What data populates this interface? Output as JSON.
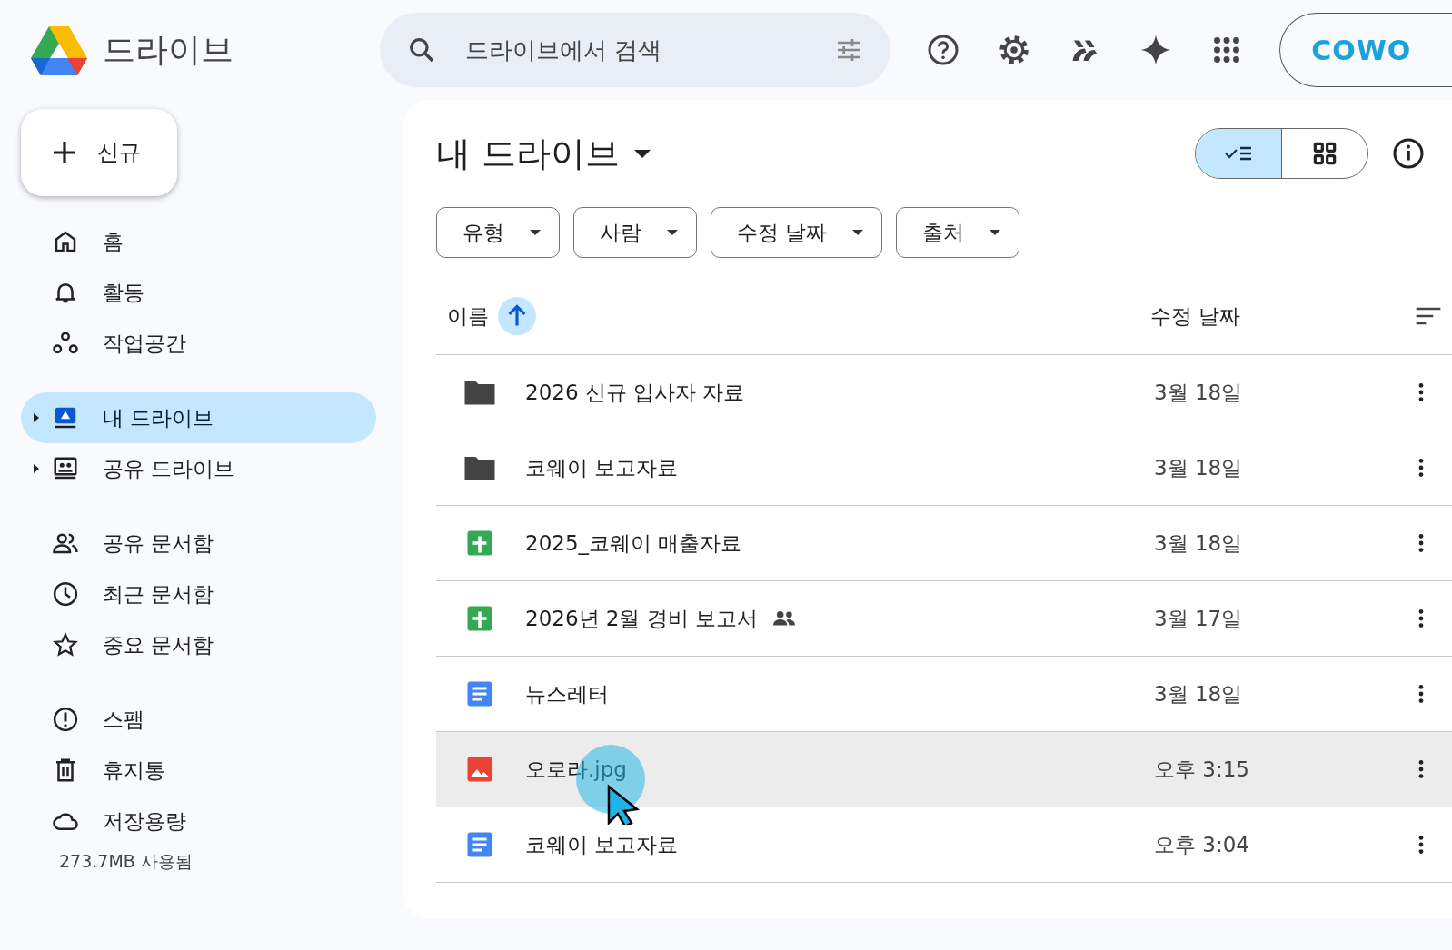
{
  "app": {
    "title": "드라이브"
  },
  "search": {
    "placeholder": "드라이브에서 검색"
  },
  "account": {
    "label": "COWO"
  },
  "new_button": {
    "label": "신규"
  },
  "sidebar": {
    "groups": [
      [
        {
          "label": "홈",
          "selected": false
        },
        {
          "label": "활동",
          "selected": false
        },
        {
          "label": "작업공간",
          "selected": false
        }
      ],
      [
        {
          "label": "내 드라이브",
          "selected": true,
          "expandable": true
        },
        {
          "label": "공유 드라이브",
          "selected": false,
          "expandable": true
        }
      ],
      [
        {
          "label": "공유 문서함",
          "selected": false
        },
        {
          "label": "최근 문서함",
          "selected": false
        },
        {
          "label": "중요 문서함",
          "selected": false
        }
      ],
      [
        {
          "label": "스팸",
          "selected": false
        },
        {
          "label": "휴지통",
          "selected": false
        },
        {
          "label": "저장용량",
          "selected": false
        }
      ]
    ],
    "storage": "273.7MB 사용됨"
  },
  "main": {
    "title": "내 드라이브",
    "view": {
      "list_selected": true
    },
    "filters": [
      "유형",
      "사람",
      "수정 날짜",
      "출처"
    ],
    "columns": {
      "name": "이름",
      "modified": "수정 날짜"
    },
    "rows": [
      {
        "kind": "folder",
        "name": "2026 신규 입사자 자료",
        "modified": "3월 18일",
        "shared": false,
        "selected": false
      },
      {
        "kind": "folder",
        "name": "코웨이 보고자료",
        "modified": "3월 18일",
        "shared": false,
        "selected": false
      },
      {
        "kind": "sheet",
        "name": "2025_코웨이 매출자료",
        "modified": "3월 18일",
        "shared": false,
        "selected": false
      },
      {
        "kind": "sheet",
        "name": "2026년 2월 경비 보고서",
        "modified": "3월 17일",
        "shared": true,
        "selected": false
      },
      {
        "kind": "doc",
        "name": "뉴스레터",
        "modified": "3월 18일",
        "shared": false,
        "selected": false
      },
      {
        "kind": "image",
        "name": "오로라.jpg",
        "modified": "오후 3:15",
        "shared": false,
        "selected": true
      },
      {
        "kind": "doc",
        "name": "코웨이 보고자료",
        "modified": "오후 3:04",
        "shared": false,
        "selected": false
      }
    ]
  }
}
